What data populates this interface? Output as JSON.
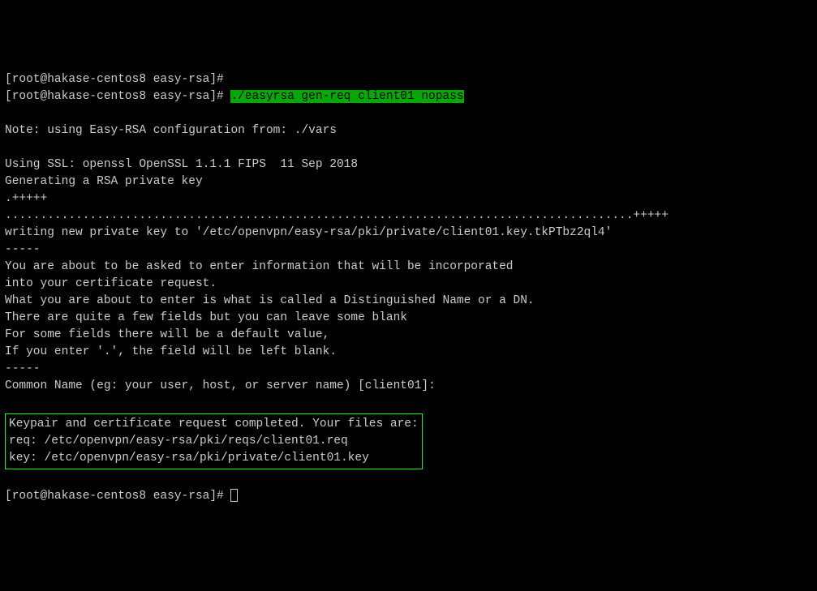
{
  "terminal": {
    "prompt1": "[root@hakase-centos8 easy-rsa]#",
    "prompt2": "[root@hakase-centos8 easy-rsa]# ",
    "command": "./easyrsa gen-req client01 nopass",
    "blank1": "",
    "note_line": "Note: using Easy-RSA configuration from: ./vars",
    "blank2": "",
    "ssl_line": "Using SSL: openssl OpenSSL 1.1.1 FIPS  11 Sep 2018",
    "gen_line": "Generating a RSA private key",
    "dots1": ".+++++",
    "dots2": ".........................................................................................+++++",
    "writing_line": "writing new private key to '/etc/openvpn/easy-rsa/pki/private/client01.key.tkPTbz2ql4'",
    "dashes1": "-----",
    "info1": "You are about to be asked to enter information that will be incorporated",
    "info2": "into your certificate request.",
    "info3": "What you are about to enter is what is called a Distinguished Name or a DN.",
    "info4": "There are quite a few fields but you can leave some blank",
    "info5": "For some fields there will be a default value,",
    "info6": "If you enter '.', the field will be left blank.",
    "dashes2": "-----",
    "common_name": "Common Name (eg: your user, host, or server name) [client01]:",
    "blank3": "",
    "box_line1": "Keypair and certificate request completed. Your files are:",
    "box_line2": "req: /etc/openvpn/easy-rsa/pki/reqs/client01.req",
    "box_line3": "key: /etc/openvpn/easy-rsa/pki/private/client01.key",
    "blank4": "",
    "final_prompt": "[root@hakase-centos8 easy-rsa]# "
  }
}
